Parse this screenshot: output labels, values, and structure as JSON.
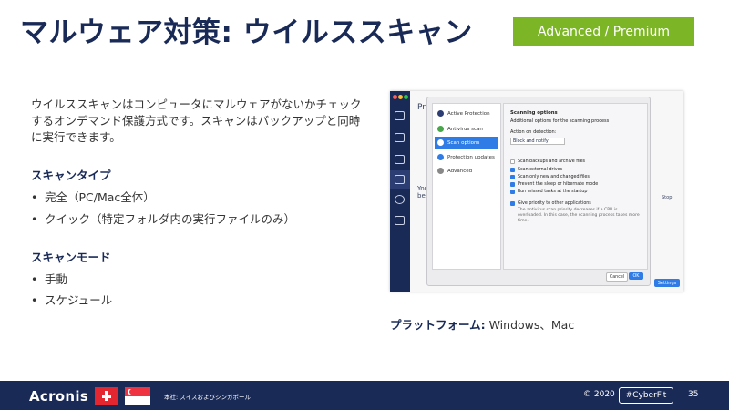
{
  "title": "マルウェア対策: ウイルススキャン",
  "badge": "Advanced / Premium",
  "intro": "ウイルススキャンはコンピュータにマルウェアがないかチェックするオンデマンド保護方式です。スキャンはバックアップと同時に実行できます。",
  "scan_types": {
    "heading": "スキャンタイプ",
    "items": [
      "完全（PC/Mac全体）",
      "クイック（特定フォルダ内の実行ファイルのみ）"
    ]
  },
  "scan_modes": {
    "heading": "スキャンモード",
    "items": [
      "手動",
      "スケジュール"
    ]
  },
  "bullet": "•",
  "platform": {
    "label": "プラットフォーム:",
    "value": " Windows、Mac"
  },
  "screenshot": {
    "bg_text": [
      "Pr",
      "You",
      "bel",
      "Stop"
    ],
    "settings_button": "Settings",
    "menu": [
      "Active Protection",
      "Antivirus scan",
      "Scan options",
      "Protection updates",
      "Advanced"
    ],
    "selected_menu_index": 2,
    "panel": {
      "heading": "Scanning options",
      "subheading": "Additional options for the scanning process",
      "action_label": "Action on detection:",
      "action_value": "Block and notify",
      "checks": [
        "Scan backups and archive files",
        "Scan external drives",
        "Scan only new and changed files",
        "Prevent the sleep or hibernate mode",
        "Run missed tasks at the startup"
      ],
      "first_check_unchecked": true,
      "priority_label": "Give priority to other applications",
      "priority_desc": "The antivirus scan priority decreases if a CPU is overloaded. In this case, the scanning process takes more time.",
      "cancel": "Cancel",
      "ok": "OK"
    }
  },
  "footer": {
    "logo": "Acronis",
    "hq": "本社: スイスおよびシンガポール",
    "copyright": "© 2020",
    "hashtag": "#CyberFit",
    "page": "35"
  },
  "colors": {
    "navy": "#1a2a57",
    "green": "#7cb526",
    "accent_blue": "#2f7ce6"
  }
}
